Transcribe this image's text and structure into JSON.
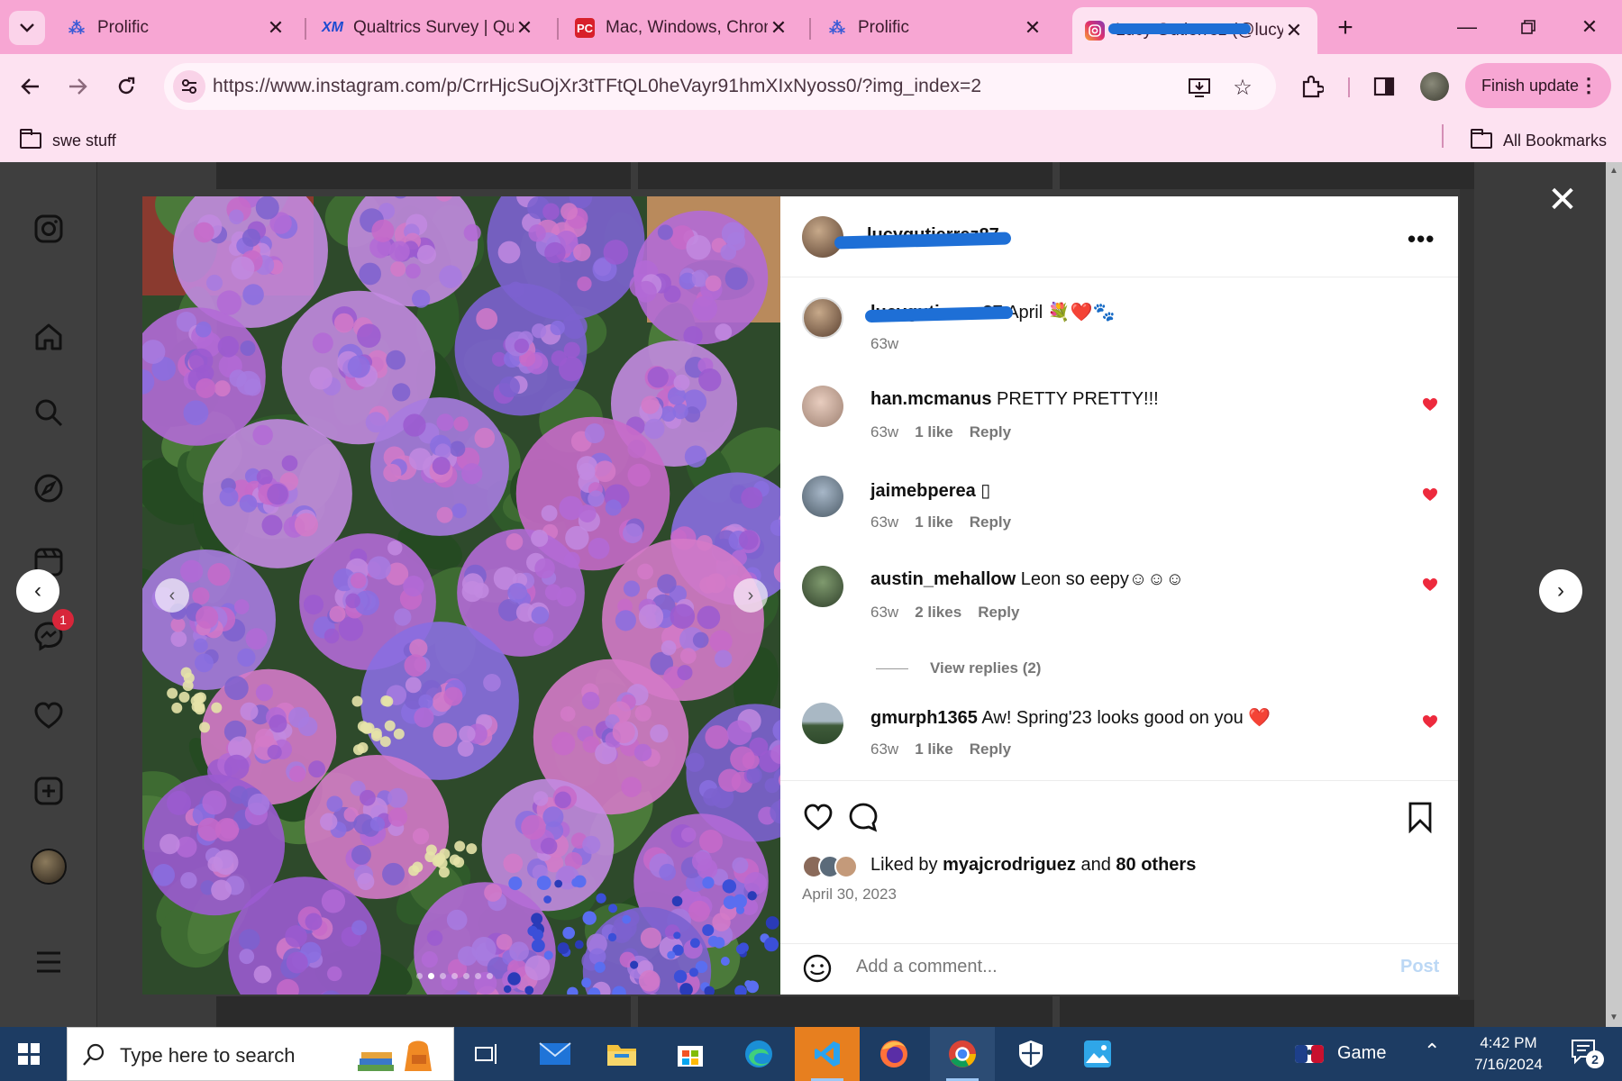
{
  "browser": {
    "tabs": [
      {
        "title": "Prolific",
        "icon": "prolific-icon"
      },
      {
        "title": "Qualtrics Survey | Qua",
        "icon": "qualtrics-icon"
      },
      {
        "title": "Mac, Windows, Chron",
        "icon": "pcmag-icon"
      },
      {
        "title": "Prolific",
        "icon": "prolific-icon"
      },
      {
        "title": "Lucy Gutierrez (@lucy",
        "icon": "instagram-icon"
      }
    ],
    "url": "https://www.instagram.com/p/CrrHjcSuOjXr3tTFtQL0heVayr91hmXIxNyoss0/?img_index=2",
    "finish_update_label": "Finish update",
    "bookmarks": [
      {
        "label": "swe stuff"
      },
      {
        "label": "All Bookmarks"
      }
    ],
    "accent_color": "#f7a6d3"
  },
  "instagram": {
    "sidebar_badge": "1",
    "post": {
      "author": "lucygutierrez87",
      "caption_author": "lucygutierrez87",
      "caption_text": "April 💐❤️🐾",
      "caption_time": "63w",
      "comments": [
        {
          "user": "han.mcmanus",
          "text": "PRETTY PRETTY!!!",
          "time": "63w",
          "likes": "1 like",
          "reply": "Reply"
        },
        {
          "user": "jaimebperea",
          "text": "▯",
          "time": "63w",
          "likes": "1 like",
          "reply": "Reply"
        },
        {
          "user": "austin_mehallow",
          "text": "Leon so eepy☺☺☺",
          "time": "63w",
          "likes": "2 likes",
          "reply": "Reply"
        },
        {
          "user": "gmurph1365",
          "text": "Aw! Spring'23 looks good on you ❤️",
          "time": "63w",
          "likes": "1 like",
          "reply": "Reply"
        }
      ],
      "view_replies": "View replies (2)",
      "liked_prefix": "Liked by",
      "liked_user": "myajcrodriguez",
      "liked_and": "and",
      "liked_others": "80 others",
      "date": "April 30, 2023",
      "add_comment_placeholder": "Add a comment...",
      "post_button": "Post",
      "heart_color": "#ed2a3d"
    }
  },
  "taskbar": {
    "search_placeholder": "Type here to search",
    "game_label": "Game",
    "time": "4:42 PM",
    "date": "7/16/2024",
    "notification_count": "2"
  }
}
